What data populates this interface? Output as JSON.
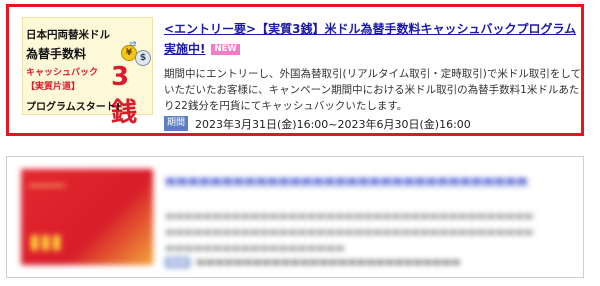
{
  "campaign": {
    "banner": {
      "line1": "日本円両替米ドル",
      "line2": "為替手数料",
      "line3": "キャッシュバック",
      "line4": "【実質片道】",
      "big": "3銭",
      "line5": "プログラムスタート!"
    },
    "title": "<エントリー要>【実質3銭】米ドル為替手数料キャッシュバックプログラム実施中!",
    "new_badge": "NEW",
    "body": "期間中にエントリーし、外国為替取引(リアルタイム取引・定時取引)で米ドル取引をしていただいたお客様に、キャンペーン期間中における米ドル取引の為替手数料1米ドルあたり22銭分を円貨にてキャッシュバックいたします。",
    "period_badge": "期間",
    "period": "2023年3月31日(金)16:00~2023年6月30日(金)16:00"
  },
  "colors": {
    "highlight_border": "#e8141f",
    "title_link": "#1a1aa6",
    "new_badge": "#f27cc6",
    "period_badge": "#5d7fc4"
  }
}
